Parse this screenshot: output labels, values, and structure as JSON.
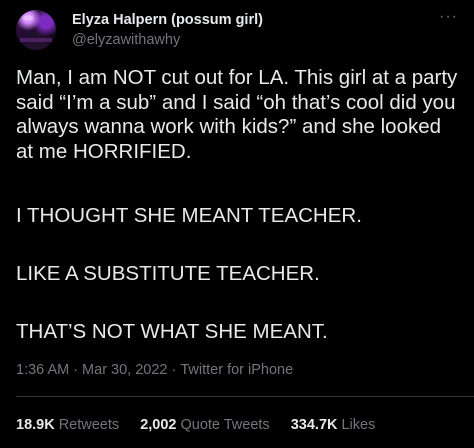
{
  "author": {
    "display_name": "Elyza Halpern (possum girl)",
    "handle": "@elyzawithawhy"
  },
  "more_icon": "more-horizontal-icon",
  "tweet": {
    "paragraphs": [
      "Man, I am NOT cut out for LA. This girl at a party said “I’m a sub” and I said “oh that’s cool did you always wanna work with kids?” and she looked at me HORRIFIED.",
      "I THOUGHT SHE MEANT TEACHER.",
      "LIKE A SUBSTITUTE TEACHER.",
      "THAT’S NOT WHAT SHE MEANT."
    ]
  },
  "meta": {
    "time": "1:36 AM",
    "date": "Mar 30, 2022",
    "source": "Twitter for iPhone",
    "separator": "·"
  },
  "stats": [
    {
      "value": "18.9K",
      "label": "Retweets"
    },
    {
      "value": "2,002",
      "label": "Quote Tweets"
    },
    {
      "value": "334.7K",
      "label": "Likes"
    }
  ],
  "colors": {
    "background": "#000000",
    "text": "#e7e9ea",
    "secondary": "#71767b",
    "divider": "#2f3336"
  }
}
